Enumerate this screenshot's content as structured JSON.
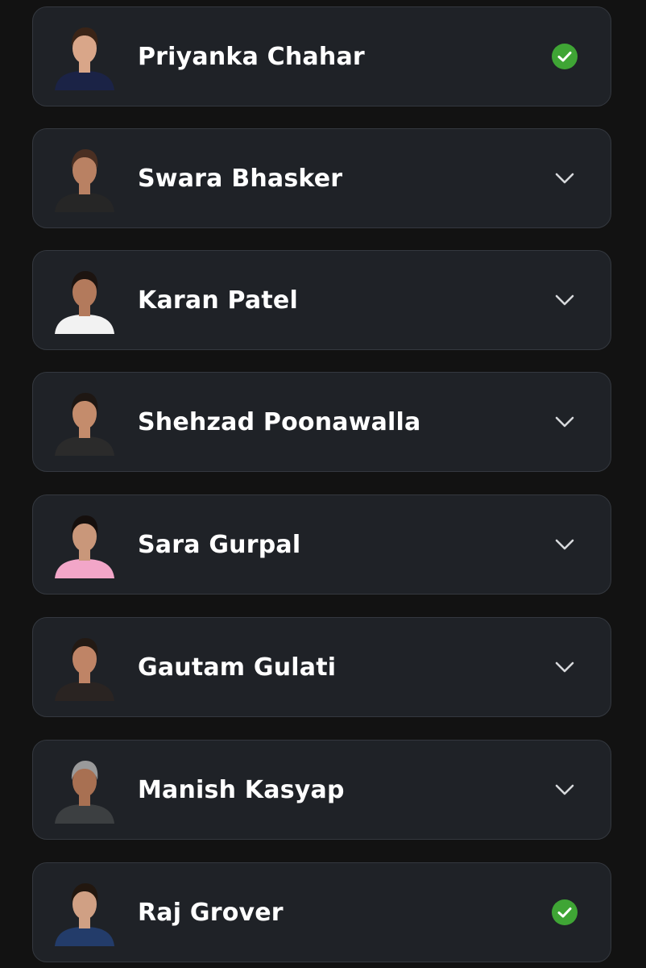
{
  "colors": {
    "background": "#121212",
    "card": "#1f2227",
    "card_border": "#34383f",
    "check": "#3fa535",
    "chevron": "#d7d9dc",
    "text": "#ffffff"
  },
  "contestants": [
    {
      "name": "Priyanka Chahar",
      "status": "selected",
      "status_icon": "check-circle-icon",
      "avatar": {
        "skin": "#d9a689",
        "hair": "#3a2417",
        "outfit": "#1b2346"
      }
    },
    {
      "name": "Swara Bhasker",
      "status": "collapsed",
      "status_icon": "chevron-down-icon",
      "avatar": {
        "skin": "#b98163",
        "hair": "#4a2f22",
        "outfit": "#262626"
      }
    },
    {
      "name": "Karan Patel",
      "status": "collapsed",
      "status_icon": "chevron-down-icon",
      "avatar": {
        "skin": "#b37a5c",
        "hair": "#1c1410",
        "outfit": "#f2f2f2"
      }
    },
    {
      "name": "Shehzad Poonawalla",
      "status": "collapsed",
      "status_icon": "chevron-down-icon",
      "avatar": {
        "skin": "#c48c6c",
        "hair": "#1e1713",
        "outfit": "#2b2b2b"
      }
    },
    {
      "name": "Sara Gurpal",
      "status": "collapsed",
      "status_icon": "chevron-down-icon",
      "avatar": {
        "skin": "#c9977a",
        "hair": "#150f0d",
        "outfit": "#f2a6c8"
      }
    },
    {
      "name": "Gautam Gulati",
      "status": "collapsed",
      "status_icon": "chevron-down-icon",
      "avatar": {
        "skin": "#bf8466",
        "hair": "#231a14",
        "outfit": "#2a2422"
      }
    },
    {
      "name": "Manish Kasyap",
      "status": "collapsed",
      "status_icon": "chevron-down-icon",
      "avatar": {
        "skin": "#a87052",
        "hair": "#9a9a9a",
        "outfit": "#3c3f41"
      }
    },
    {
      "name": "Raj Grover",
      "status": "selected",
      "status_icon": "check-circle-icon",
      "avatar": {
        "skin": "#d0a084",
        "hair": "#22170f",
        "outfit": "#233c6a"
      }
    }
  ]
}
